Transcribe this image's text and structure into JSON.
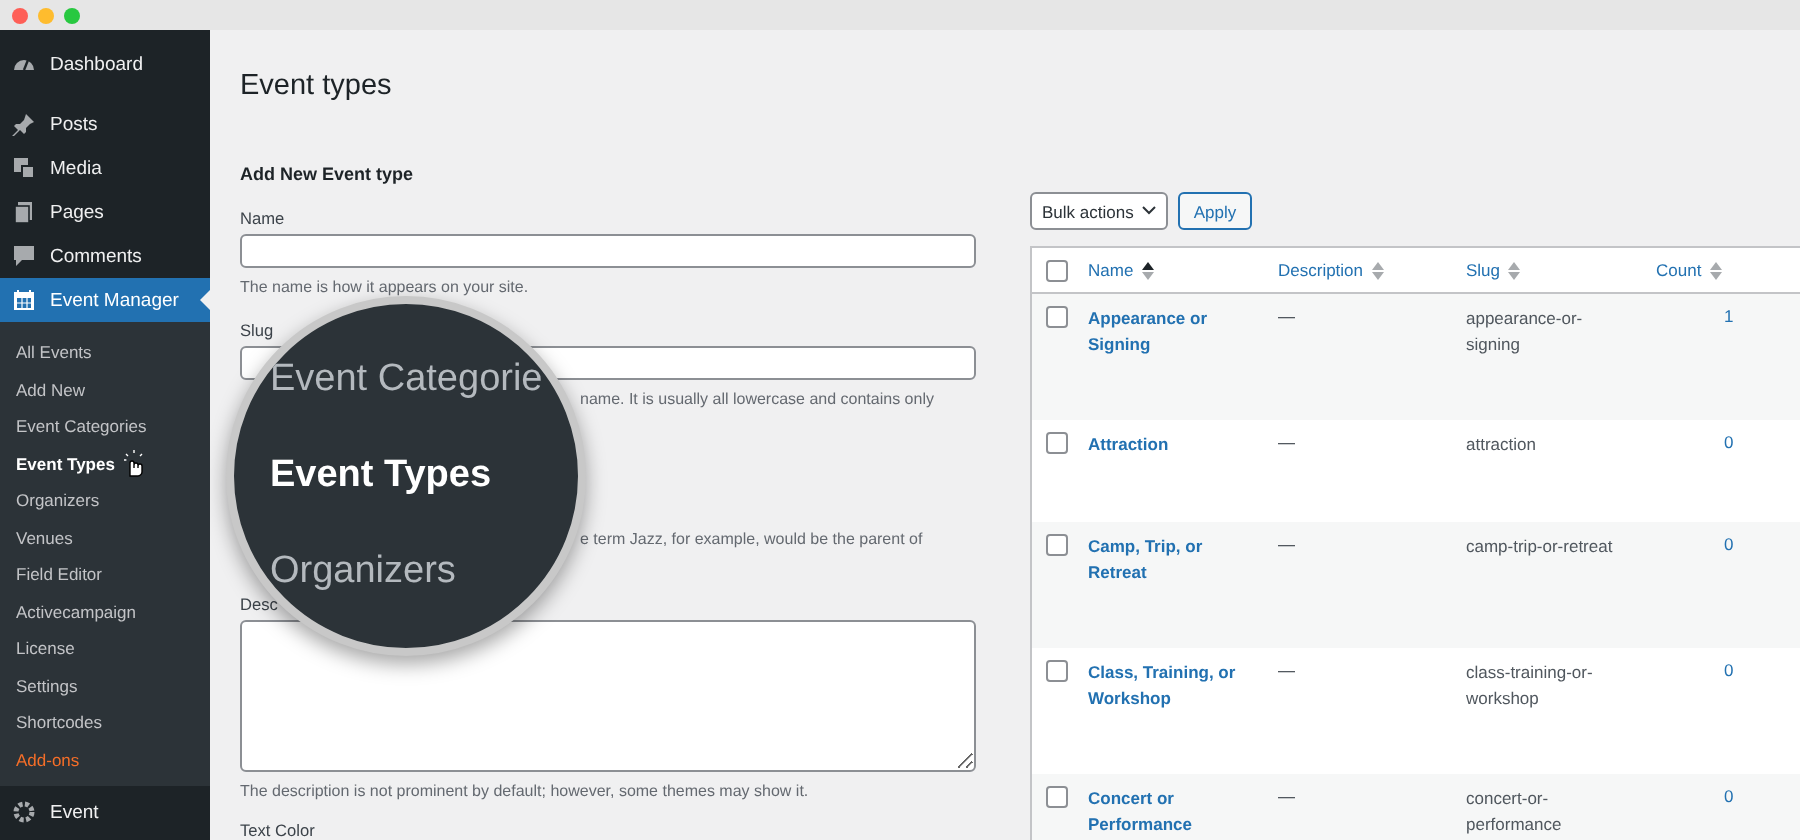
{
  "sidebar": {
    "menu": [
      {
        "label": "Dashboard",
        "selected": false
      },
      {
        "label": "Posts",
        "selected": false
      },
      {
        "label": "Media",
        "selected": false
      },
      {
        "label": "Pages",
        "selected": false
      },
      {
        "label": "Comments",
        "selected": false
      },
      {
        "label": "Event Manager",
        "selected": true
      }
    ],
    "submenu": [
      {
        "label": "All Events",
        "kind": "link",
        "selected": false
      },
      {
        "label": "Add New",
        "kind": "link",
        "selected": false
      },
      {
        "label": "Event Categories",
        "kind": "link",
        "selected": false
      },
      {
        "label": "Event Types",
        "kind": "link",
        "selected": true
      },
      {
        "label": "Organizers",
        "kind": "link",
        "selected": false
      },
      {
        "label": "Venues",
        "kind": "link",
        "selected": false
      },
      {
        "label": "Field Editor",
        "kind": "link",
        "selected": false
      },
      {
        "label": "Activecampaign",
        "kind": "link",
        "selected": false
      },
      {
        "label": "License",
        "kind": "link",
        "selected": false
      },
      {
        "label": "Settings",
        "kind": "link",
        "selected": false
      },
      {
        "label": "Shortcodes",
        "kind": "link",
        "selected": false
      },
      {
        "label": "Add-ons",
        "kind": "addon",
        "selected": false
      }
    ],
    "footer_item": {
      "label": "Event"
    }
  },
  "page": {
    "title": "Event types"
  },
  "form": {
    "heading": "Add New Event type",
    "name": {
      "label": "Name",
      "hint": "The name is how it appears on your site."
    },
    "slug": {
      "label": "Slug",
      "hint": "name. It is usually all lowercase and contains only"
    },
    "parent_hint": "e term Jazz, for example, would be the parent of",
    "description": {
      "label": "Desc",
      "hint": "The description is not prominent by default; however, some themes may show it."
    },
    "text_color": {
      "label": "Text Color"
    }
  },
  "magnifier": {
    "items": [
      {
        "label": "Event Categorie",
        "selected": false
      },
      {
        "label": "Event Types",
        "selected": true
      },
      {
        "label": "Organizers",
        "selected": false
      }
    ]
  },
  "table": {
    "bulk_actions": "Bulk actions",
    "apply": "Apply",
    "select_all_checked": false,
    "columns": [
      {
        "label": "Name",
        "sorted": true
      },
      {
        "label": "Description",
        "sorted": false
      },
      {
        "label": "Slug",
        "sorted": false
      },
      {
        "label": "Count",
        "sorted": false
      }
    ],
    "rows": [
      {
        "name": "Appearance or Signing",
        "description": "—",
        "slug": "appearance-or-signing",
        "count": "1",
        "checked": false
      },
      {
        "name": "Attraction",
        "description": "—",
        "slug": "attraction",
        "count": "0",
        "checked": false
      },
      {
        "name": "Camp, Trip, or Retreat",
        "description": "—",
        "slug": "camp-trip-or-retreat",
        "count": "0",
        "checked": false
      },
      {
        "name": "Class, Training, or Workshop",
        "description": "—",
        "slug": "class-training-or-workshop",
        "count": "0",
        "checked": false
      },
      {
        "name": "Concert or Performance",
        "description": "—",
        "slug": "concert-or-performance",
        "count": "0",
        "checked": false
      }
    ]
  }
}
